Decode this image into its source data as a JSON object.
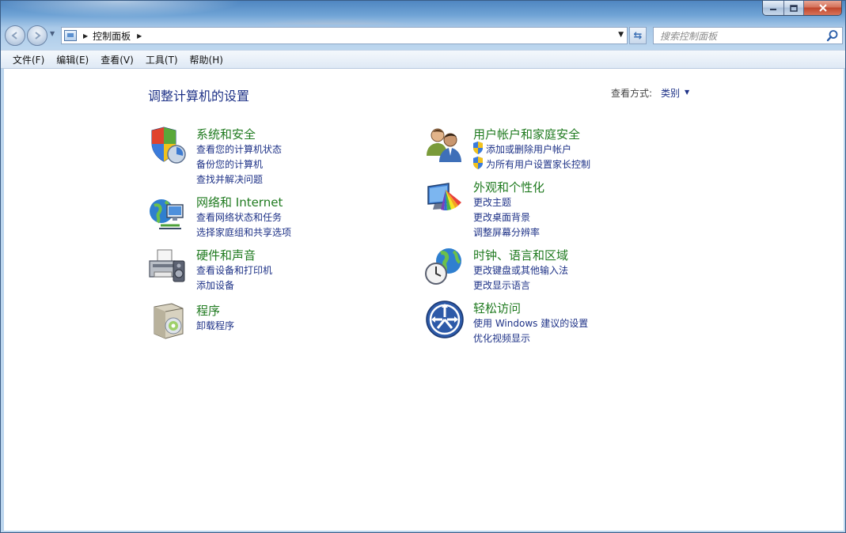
{
  "address": {
    "path": "控制面板",
    "search_placeholder": "搜索控制面板"
  },
  "menu": [
    "文件(F)",
    "编辑(E)",
    "查看(V)",
    "工具(T)",
    "帮助(H)"
  ],
  "main": {
    "title": "调整计算机的设置",
    "view_label": "查看方式:",
    "view_value": "类别"
  },
  "categories": {
    "system": {
      "title": "系统和安全",
      "links": [
        "查看您的计算机状态",
        "备份您的计算机",
        "查找并解决问题"
      ]
    },
    "network": {
      "title": "网络和 Internet",
      "links": [
        "查看网络状态和任务",
        "选择家庭组和共享选项"
      ]
    },
    "hardware": {
      "title": "硬件和声音",
      "links": [
        "查看设备和打印机",
        "添加设备"
      ]
    },
    "programs": {
      "title": "程序",
      "links": [
        "卸载程序"
      ]
    },
    "users": {
      "title": "用户帐户和家庭安全",
      "links": [
        "添加或删除用户帐户",
        "为所有用户设置家长控制"
      ]
    },
    "appearance": {
      "title": "外观和个性化",
      "links": [
        "更改主题",
        "更改桌面背景",
        "调整屏幕分辨率"
      ]
    },
    "clock": {
      "title": "时钟、语言和区域",
      "links": [
        "更改键盘或其他输入法",
        "更改显示语言"
      ]
    },
    "ease": {
      "title": "轻松访问",
      "links": [
        "使用 Windows 建议的设置",
        "优化视频显示"
      ]
    }
  }
}
